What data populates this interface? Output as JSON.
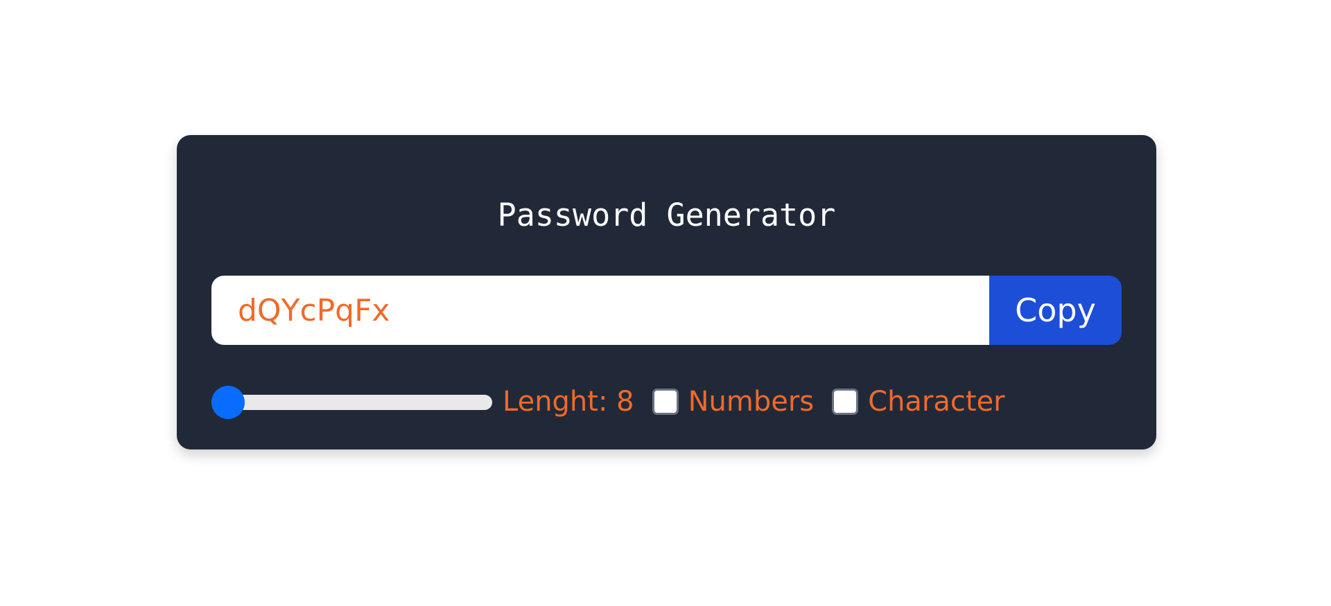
{
  "app": {
    "title": "Password Generator"
  },
  "password": {
    "value": "dQYcPqFx",
    "copy_label": "Copy"
  },
  "options": {
    "length_label": "Lenght: 8",
    "length_value": 8,
    "length_fraction": 0,
    "numbers_label": "Numbers",
    "numbers_checked": false,
    "character_label": "Character",
    "character_checked": false
  },
  "colors": {
    "card_bg": "#212938",
    "accent_text": "#f06a2a",
    "copy_button": "#1d4ed8",
    "slider_thumb": "#0a6cff"
  }
}
